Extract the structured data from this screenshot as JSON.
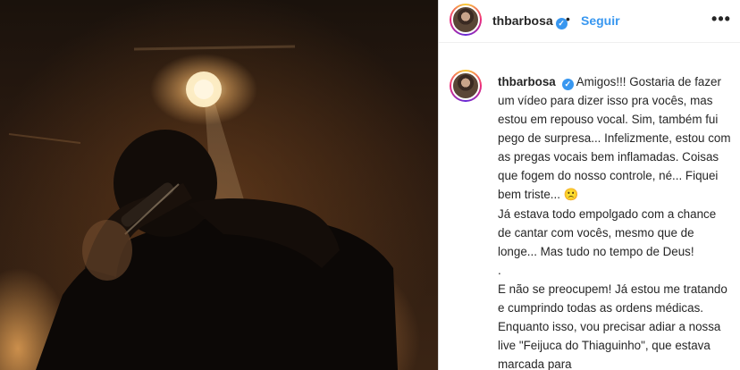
{
  "post": {
    "image_alt": "Cantor em show, silhueta contra a luz de palco"
  },
  "header": {
    "username": "thbarbosa",
    "verified_icon": "verified-check-icon",
    "separator": "•",
    "follow_label": "Seguir",
    "more_icon": "•••"
  },
  "caption": {
    "username": "thbarbosa",
    "verified_icon": "verified-check-icon",
    "line1": "Amigos!!! Gostaria de fazer um vídeo para dizer isso pra vocês, mas estou em repouso vocal. Sim, também fui pego de surpresa... Infelizmente, estou com as pregas vocais bem inflamadas. Coisas que fogem do nosso controle, né... Fiquei bem triste...",
    "emoji": "🙁",
    "line2": "Já estava todo empolgado com a chance de cantar com vocês, mesmo que de longe... Mas tudo no tempo de Deus!",
    "line3": ".",
    "line4": "E não se preocupem! Já estou me tratando e cumprindo todas as ordens médicas. Enquanto isso, vou precisar adiar a nossa live \"Feijuca do Thiaguinho\", que estava marcada para"
  },
  "colors": {
    "link_blue": "#3897f0",
    "text": "#262626",
    "border": "#dbdbdb"
  }
}
